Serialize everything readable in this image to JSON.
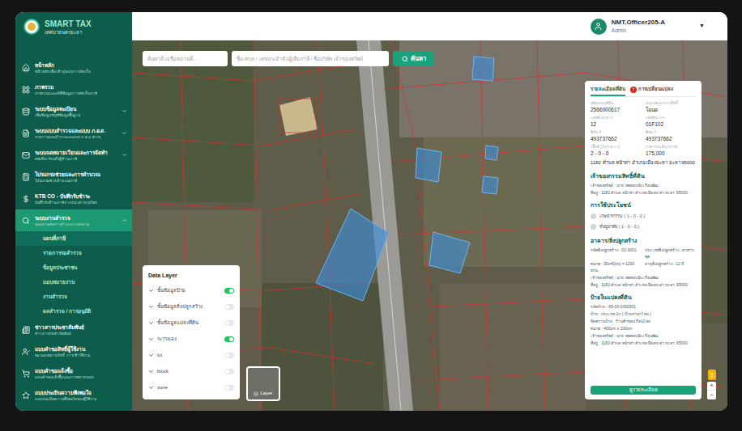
{
  "app": {
    "title": "SMART TAX",
    "subtitle": "เทศบาลนครยะลา"
  },
  "sidebar": {
    "items": [
      {
        "label": "หน้าหลัก",
        "sublabel": "หน้าหลักเพื่อเข้าสู่ระบบการจัดเก็บ",
        "kind": "link",
        "expanded": false,
        "selected": false,
        "children": []
      },
      {
        "label": "ภาพรวม",
        "sublabel": "ภาพรวมและสถิติข้อมูลการจัดเก็บภาษี",
        "kind": "link",
        "expanded": false,
        "selected": false,
        "children": []
      },
      {
        "label": "ระบบข้อมูลทะเบียน",
        "sublabel": "เพิ่มข้อมูลบัญชีข้อมูลพื้นฐาน",
        "kind": "group",
        "expanded": false,
        "selected": false,
        "children": []
      },
      {
        "label": "ระบบแบบสำรวจและแบบ ภ.ด.ส.",
        "sublabel": "รายการแบบสำรวจและแบบ ภ.ด.ส. ต่างๆ",
        "kind": "group",
        "expanded": false,
        "selected": false,
        "children": []
      },
      {
        "label": "ระบบจดหมายเวียนและการจัดทำ",
        "sublabel": "หนังสือเวียนถึงผู้ชำระภาษี",
        "kind": "group",
        "expanded": false,
        "selected": false,
        "children": []
      },
      {
        "label": "โปรแกรมช่วยและการคำนวณ",
        "sublabel": "โปรแกรมช่วยคำนวณภาษี",
        "kind": "link",
        "expanded": false,
        "selected": false,
        "children": []
      },
      {
        "label": "KTB CO - บันทึกรับชำระ",
        "sublabel": "บันทึกรับชำระภาษีจากธนาคารกรุงไทย",
        "kind": "link",
        "expanded": false,
        "selected": false,
        "children": []
      },
      {
        "label": "ระบบงานสำรวจ",
        "sublabel": "ระบบงานจัดการสำรวจภาคสนาม",
        "kind": "group",
        "expanded": true,
        "selected": true,
        "children": [
          {
            "label": "แผนที่ภาษี",
            "selected": true
          },
          {
            "label": "รายการรอสำรวจ",
            "selected": false
          },
          {
            "label": "ข้อมูลประชาชน",
            "selected": false
          },
          {
            "label": "มอบหมายงาน",
            "selected": false
          },
          {
            "label": "งานสำรวจ",
            "selected": false
          },
          {
            "label": "ผลสำรวจ / การอนุมัติ",
            "selected": false
          }
        ]
      },
      {
        "label": "ข่าวสารประชาสัมพันธ์",
        "sublabel": "ข่าวสารประชาสัมพันธ์",
        "kind": "link",
        "expanded": false,
        "selected": false,
        "children": []
      },
      {
        "label": "แบบคำขอสิทธิ์ผู้ใช้งาน",
        "sublabel": "ขอ มอบหมายสิทธิ์ การเข้าใช้งาน",
        "kind": "link",
        "expanded": false,
        "selected": false,
        "children": []
      },
      {
        "label": "แบบคำขอแจ้งซื้อ",
        "sublabel": "แบบคำขอแจ้งซื้อและการขยายระบบ",
        "kind": "link",
        "expanded": false,
        "selected": false,
        "children": []
      },
      {
        "label": "แบบประเมินความพึงพอใจ",
        "sublabel": "แบบประเมินความพึงพอใจของผู้ใช้งาน",
        "kind": "link",
        "expanded": false,
        "selected": false,
        "children": []
      }
    ]
  },
  "user": {
    "name": "NMT.Officer205-A",
    "role": "Admin",
    "caret": "▼"
  },
  "search": {
    "place_placeholder": "ค้นหาด้วยชื่อสถานที่...",
    "owner_placeholder": "ชื่อ-สกุล / เลขประจำตัวผู้เสียภาษี / ชื่อบริษัท เจ้าของทรัพย์",
    "button": "ค้นหา"
  },
  "layers": {
    "title": "Data Layer",
    "items": [
      {
        "label": "ชั้นข้อมูลป้าย",
        "on": true
      },
      {
        "label": "ชั้นข้อมูลสิ่งปลูกสร้าง",
        "on": false
      },
      {
        "label": "ชั้นข้อมูลแปลงที่ดิน",
        "on": false
      },
      {
        "label": "ระวางเอง",
        "on": true
      },
      {
        "label": "lot",
        "on": false
      },
      {
        "label": "block",
        "on": false
      },
      {
        "label": "zone",
        "on": false
      }
    ]
  },
  "layer_button": "Layer",
  "info": {
    "tabs": [
      {
        "label": "รายละเอียดที่ดิน",
        "selected": true,
        "badge": ""
      },
      {
        "label": "การเปลี่ยนแปลง",
        "selected": false,
        "badge": "!"
      }
    ],
    "fields": [
      {
        "label": "รหัสแปลงที่ดิน",
        "value": "2566000617"
      },
      {
        "label": "ประเภทเอกสารสิทธิ์",
        "value": "โฉนด"
      },
      {
        "label": "เลขที่เอกสาร",
        "value": "12"
      },
      {
        "label": "เลขที่ระวาง",
        "value": "01F102"
      },
      {
        "label": "พิกัด X",
        "value": "493737662"
      },
      {
        "label": "พิกัด Y",
        "value": "493737662"
      },
      {
        "label": "เนื้อที่ (ไร่-งาน-วา)",
        "value": "2 - 0 - 0"
      },
      {
        "label": "ราคาประเมิน (บาท)",
        "value": "175,000"
      }
    ],
    "address": "1182 ตำบล หน้าท่า อำเภอเมืองยะลา ยะลา 95000",
    "sections": [
      {
        "title": "เจ้าของกรรมสิทธิ์ที่ดิน",
        "lines": [
          {
            "text": "เจ้าของทรัพย์ : นาย ทดสอบนับ เรือนพัฒ",
            "kind": "full"
          },
          {
            "text": "ที่อยู่ : 1182 ตำบล หน้าท่า อำเภอเมืองยะลา ยะลา 95000",
            "kind": "full"
          }
        ]
      },
      {
        "title": "การใช้ประโยชน์",
        "lines": [
          {
            "text": "เกษตรกรรม ( 1 - 0 - 0 )",
            "kind": "radio"
          },
          {
            "text": "ที่อยู่อาศัย ( 1 - 0 - 0 )",
            "kind": "radio"
          }
        ]
      },
      {
        "title": "อาคาร/สิ่งปลูกสร้าง",
        "lines": [
          {
            "text": "รหัสสิ่งปลูกสร้าง : 01-0001",
            "kind": "half"
          },
          {
            "text": "ประเภทสิ่งปลูกสร้าง : อาคารชุด",
            "kind": "half"
          },
          {
            "text": "ขนาด : 30x40(m) = 1200 ตรม.",
            "kind": "half"
          },
          {
            "text": "อายุสิ่งปลูกสร้าง : 12 ปี",
            "kind": "half"
          },
          {
            "text": "เจ้าของทรัพย์ : นาย ทดสอบนับ เรือนพัฒ",
            "kind": "full"
          },
          {
            "text": "ที่อยู่ : 1182 ตำบล หน้าท่า อำเภอเมืองยะลา ยะลา 95000",
            "kind": "full"
          }
        ]
      },
      {
        "title": "ป้ายในแปลงที่ดิน",
        "lines": [
          {
            "text": "รหัสป้าย : 65-03-0002901",
            "kind": "full"
          },
          {
            "text": "ป้าย : ประเภท 1ก ( ป้ายภาษาไทย )",
            "kind": "full"
          },
          {
            "text": "ข้อความป้าย : ร้านค้าของเรือนไทย",
            "kind": "full"
          },
          {
            "text": "ขนาด : 400cm x 100cm",
            "kind": "full"
          },
          {
            "text": "เจ้าของทรัพย์ : นาย ทดสอบนับ เรือนพัฒ",
            "kind": "full"
          },
          {
            "text": "ที่อยู่ : 1182 ตำบล หน้าท่า อำเภอเมืองยะลา ยะลา 95000",
            "kind": "full"
          }
        ]
      }
    ],
    "button": "ดูรายละเอียด"
  },
  "map_controls": {
    "zoom_in": "+",
    "zoom_out": "−"
  }
}
